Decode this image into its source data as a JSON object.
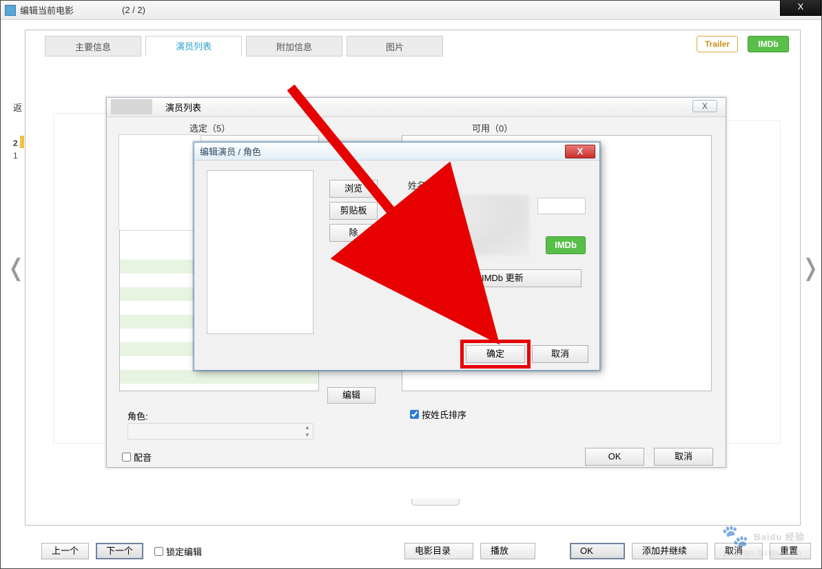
{
  "window": {
    "title_prefix": "编辑当前电影",
    "title_count": "(2 / 2)"
  },
  "tabs": {
    "main_info": "主要信息",
    "actor_list": "演员列表",
    "extra_info": "附加信息",
    "image": "图片"
  },
  "side_buttons": {
    "trailer": "Trailer",
    "imdb": "IMDb"
  },
  "left_edge": {
    "back_text": "返",
    "row1": "2",
    "row2": "1"
  },
  "actor_dialog": {
    "title": "演员列表",
    "selected_label": "选定（5）",
    "available_label": "可用（0）",
    "edit_button": "编辑",
    "role_label": "角色:",
    "sort_label": "按姓氏排序",
    "voice_label": "配音",
    "ok": "OK",
    "cancel": "取消"
  },
  "edit_dialog": {
    "title": "编辑演员 / 角色",
    "browse": "浏览",
    "clipboard": "剪贴板",
    "remove": "除",
    "name_label": "姓名:",
    "imdb": "IMDb",
    "update": "从 IMDb 更新",
    "ok": "确定",
    "cancel": "取消"
  },
  "bottom": {
    "prev": "上一个",
    "next": "下一个",
    "lock_edit": "锁定编辑",
    "movie_catalog": "电影目录",
    "play": "播放",
    "ok": "OK",
    "add_continue": "添加并继续",
    "cancel": "取消",
    "reset": "重置"
  },
  "watermark": {
    "brand": "Baidu 经验",
    "url": "jingyan.baidu.com"
  }
}
